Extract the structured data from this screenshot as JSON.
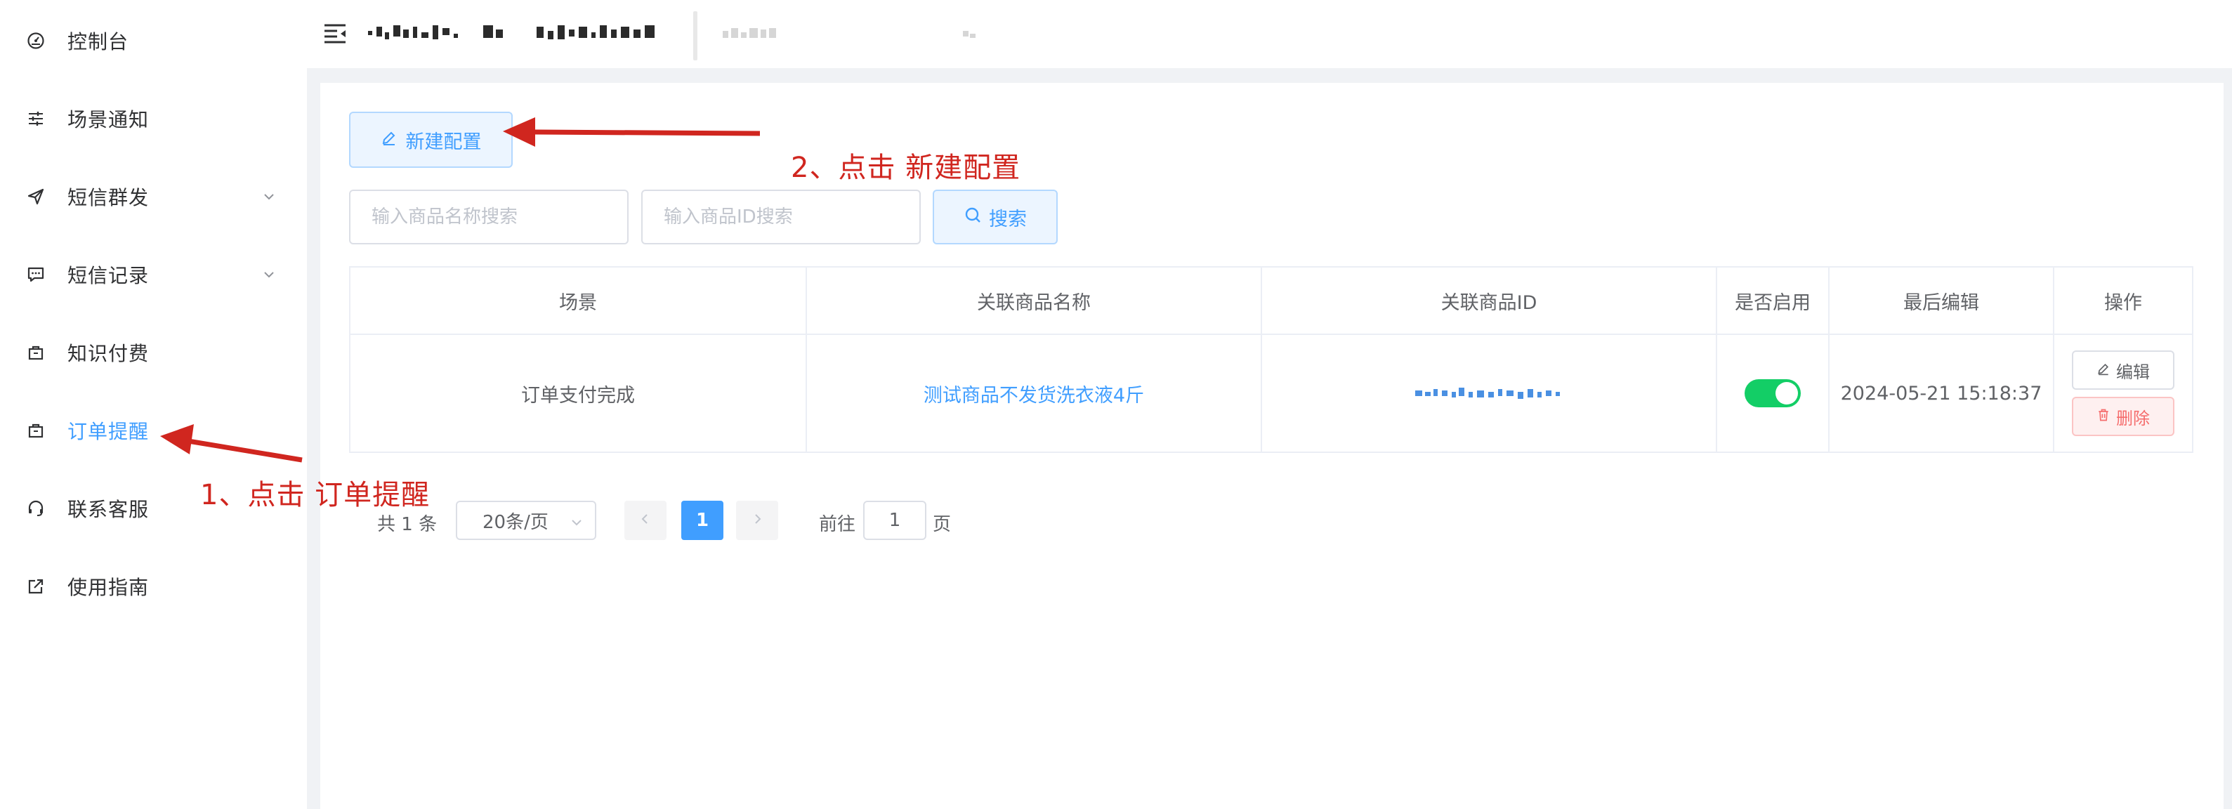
{
  "sidebar": {
    "items": [
      {
        "label": "控制台",
        "icon": "dashboard-icon",
        "has_chevron": false
      },
      {
        "label": "场景通知",
        "icon": "sliders-icon",
        "has_chevron": false
      },
      {
        "label": "短信群发",
        "icon": "send-icon",
        "has_chevron": true
      },
      {
        "label": "短信记录",
        "icon": "message-icon",
        "has_chevron": true
      },
      {
        "label": "知识付费",
        "icon": "bag-icon",
        "has_chevron": false
      },
      {
        "label": "订单提醒",
        "icon": "bag-icon",
        "has_chevron": false,
        "active": true
      },
      {
        "label": "联系客服",
        "icon": "headset-icon",
        "has_chevron": false
      },
      {
        "label": "使用指南",
        "icon": "external-link-icon",
        "has_chevron": false
      }
    ]
  },
  "toolbar": {
    "new_config_label": "新建配置",
    "search_button_label": "搜索"
  },
  "search": {
    "name_placeholder": "输入商品名称搜索",
    "id_placeholder": "输入商品ID搜索"
  },
  "table": {
    "headers": [
      "场景",
      "关联商品名称",
      "关联商品ID",
      "是否启用",
      "最后编辑",
      "操作"
    ],
    "rows": [
      {
        "scene": "订单支付完成",
        "product_name": "测试商品不发货洗衣液4斤",
        "enabled": true,
        "last_edit": "2024-05-21 15:18:37",
        "edit_label": "编辑",
        "delete_label": "删除"
      }
    ]
  },
  "pagination": {
    "total_text": "共 1 条",
    "page_size": "20条/页",
    "current_page": "1",
    "goto_label": "前往",
    "goto_value": "1",
    "page_suffix": "页"
  },
  "annotations": {
    "step1": "1、点击 订单提醒",
    "step2": "2、点击 新建配置"
  },
  "colors": {
    "accent": "#409eff",
    "success": "#13ce66",
    "danger": "#f56c6c",
    "annotation": "#d0261f"
  }
}
